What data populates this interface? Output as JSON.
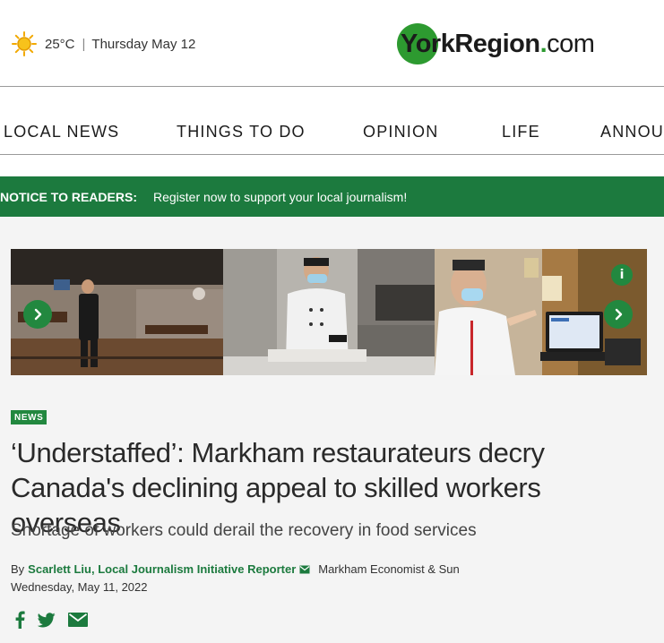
{
  "header": {
    "temperature": "25°C",
    "separator": "|",
    "date": "Thursday May 12",
    "logo": {
      "brand": "YorkRegion",
      "dot": ".",
      "tld": "com"
    }
  },
  "nav": {
    "items": [
      {
        "label": "LOCAL NEWS"
      },
      {
        "label": "THINGS TO DO"
      },
      {
        "label": "OPINION"
      },
      {
        "label": "LIFE"
      },
      {
        "label": "ANNOU"
      }
    ]
  },
  "notice": {
    "label": "NOTICE TO READERS:",
    "link": "Register now to support your local journalism!"
  },
  "gallery": {
    "info_label": "i"
  },
  "article": {
    "badge": "NEWS",
    "headline": "‘Understaffed’: Markham restaurateurs decry Canada's declining appeal to skilled workers overseas",
    "subheadline": "Shortage of workers could derail the recovery in food services",
    "by_prefix": "By",
    "author": "Scarlett Liu, Local Journalism Initiative Reporter",
    "publication": "Markham Economist & Sun",
    "date": "Wednesday, May 11, 2022"
  },
  "colors": {
    "brand_green": "#1c7a3e",
    "accent_green": "#22883f"
  },
  "icons": {
    "weather": "sun-icon",
    "prev": "chevron-left-icon",
    "next": "chevron-right-icon",
    "info": "info-icon",
    "author_mail": "mail-icon",
    "share": [
      "facebook-icon",
      "twitter-icon",
      "email-icon"
    ]
  }
}
